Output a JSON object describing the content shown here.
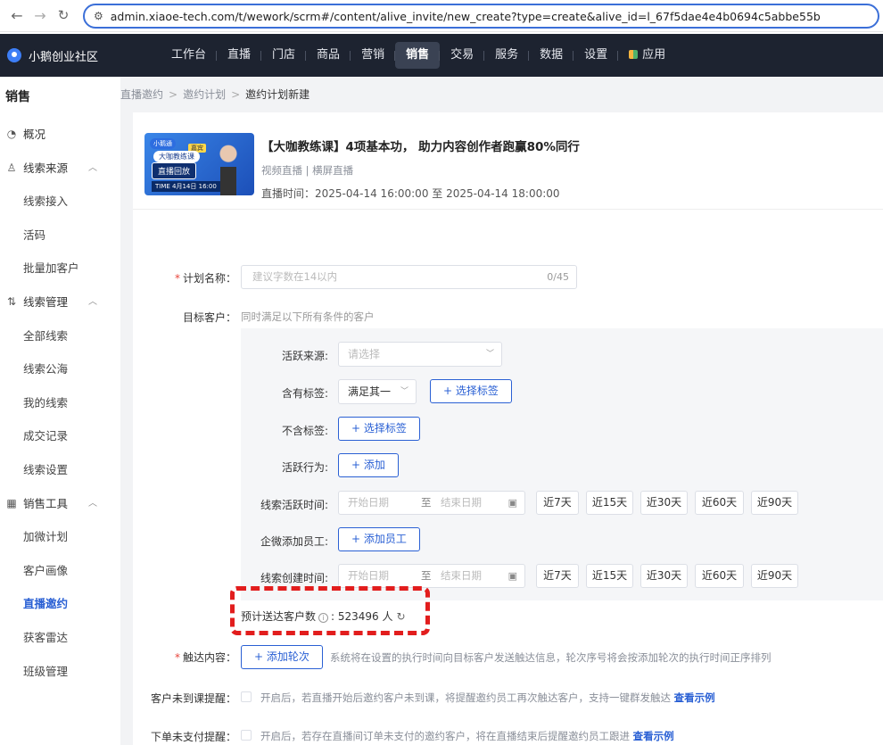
{
  "browser": {
    "url": "admin.xiaoe-tech.com/t/wework/scrm#/content/alive_invite/new_create?type=create&alive_id=l_67f5dae4e4b0694c5abbe55b"
  },
  "topnav": {
    "brand": "小鹅创业社区",
    "items": [
      "工作台",
      "直播",
      "门店",
      "商品",
      "营销",
      "销售",
      "交易",
      "服务",
      "数据",
      "设置",
      "应用"
    ],
    "active": "销售"
  },
  "sidebar": {
    "title": "销售",
    "overview": "概况",
    "group1": "线索来源",
    "g1_items": [
      "线索接入",
      "活码",
      "批量加客户"
    ],
    "group2": "线索管理",
    "g2_items": [
      "全部线索",
      "线索公海",
      "我的线索",
      "成交记录",
      "线索设置"
    ],
    "group3": "销售工具",
    "g3_items": [
      "加微计划",
      "客户画像",
      "直播邀约",
      "获客雷达",
      "班级管理"
    ],
    "active": "直播邀约"
  },
  "breadcrumb": [
    "直播邀约",
    "邀约计划",
    "邀约计划新建"
  ],
  "live": {
    "title": "【大咖教练课】4项基本功， 助力内容创作者跑赢80%同行",
    "type": "视频直播 | 横屏直播",
    "time": "直播时间：2025-04-14 16:00:00 至 2025-04-14 18:00:00",
    "thumb_badge": "小鹅通",
    "thumb_tag1": "大咖教练课",
    "thumb_tag2": "直播回放",
    "thumb_time": "TIME  4月14日 16:00",
    "thumb_name": "嘉宾"
  },
  "form": {
    "plan_name_label": "计划名称：",
    "plan_name_placeholder": "建议字数在14以内",
    "plan_name_count": "0/45",
    "target_label": "目标客户：",
    "target_hint": "同时满足以下所有条件的客户",
    "active_source_label": "活跃来源:",
    "active_source_placeholder": "请选择",
    "include_tags_label": "含有标签:",
    "include_tags_mode": "满足其一",
    "select_tags_btn": "+ 选择标签",
    "exclude_tags_label": "不含标签:",
    "exclude_tags_btn": "+ 选择标签",
    "behavior_label": "活跃行为:",
    "behavior_btn": "+ 添加",
    "active_time_label": "线索活跃时间:",
    "start_date": "开始日期",
    "to": "至",
    "end_date": "结束日期",
    "quick_ranges": [
      "近7天",
      "近15天",
      "近30天",
      "近60天",
      "近90天"
    ],
    "staff_label": "企微添加员工:",
    "staff_btn": "+ 添加员工",
    "create_time_label": "线索创建时间:",
    "estimate_label": "预计送达客户数",
    "estimate_value": "523496 人",
    "reach_label": "触达内容：",
    "add_round_btn": "+ 添加轮次",
    "reach_desc": "系统将在设置的执行时间向目标客户发送触达信息，轮次序号将会按添加轮次的执行时间正序排列",
    "absent_label": "客户未到课提醒：",
    "absent_desc": "开启后，若直播开始后邀约客户未到课，将提醒邀约员工再次触达客户，支持一键群发触达",
    "absent_link": "查看示例",
    "unpaid_label": "下单未支付提醒：",
    "unpaid_desc": "开启后，若存在直播间订单未支付的邀约客户，将在直播结束后提醒邀约员工跟进",
    "unpaid_link": "查看示例"
  }
}
